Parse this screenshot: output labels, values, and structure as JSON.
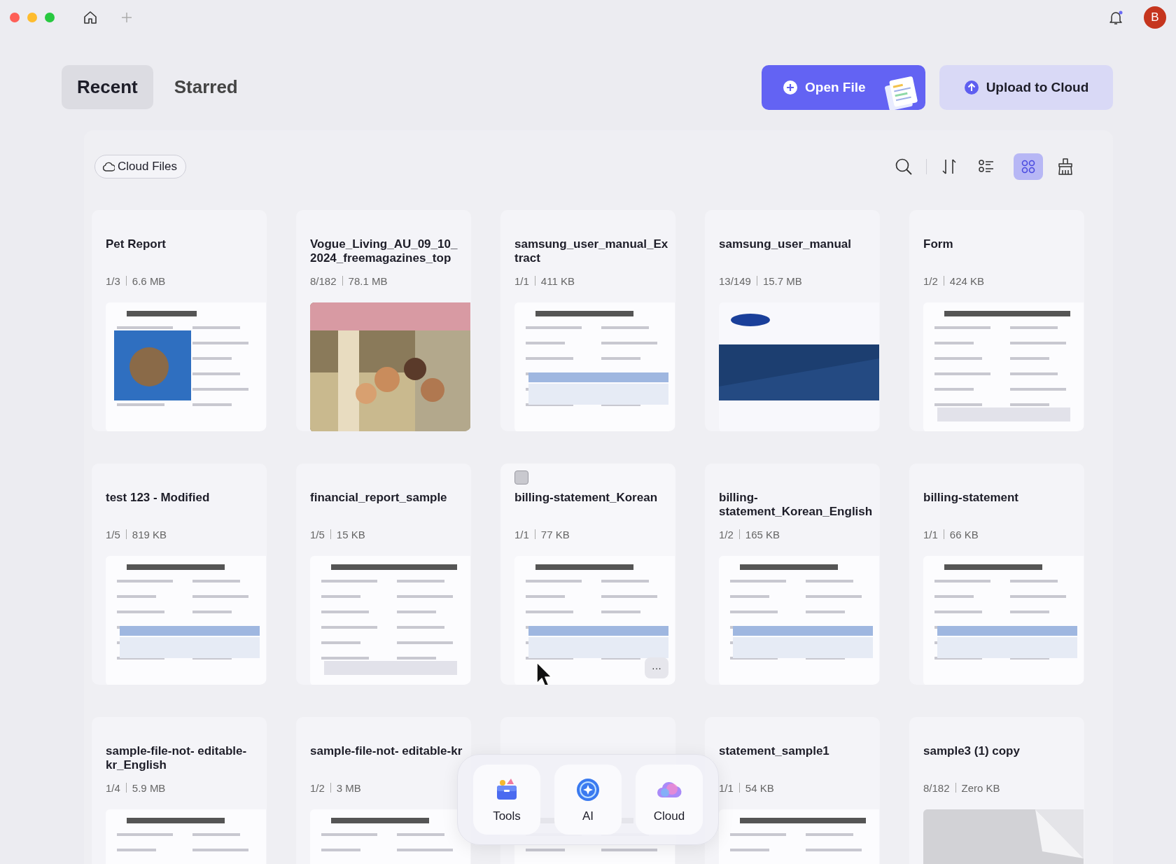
{
  "titlebar": {
    "avatar_initial": "B",
    "notification_dot": true
  },
  "tabs": [
    {
      "label": "Recent",
      "selected": true
    },
    {
      "label": "Starred",
      "selected": false
    }
  ],
  "actions": [
    {
      "label": "Open File",
      "kind": "primary"
    },
    {
      "label": "Upload to Cloud",
      "kind": "secondary"
    }
  ],
  "cloud_filter": {
    "label": "Cloud Files"
  },
  "view_buttons": [
    {
      "kind": "list",
      "selected": false
    },
    {
      "kind": "grid",
      "selected": true
    }
  ],
  "cards": [
    {
      "title": "Pet Report",
      "pages": "1/3",
      "size": "6.6 MB",
      "hovered": false
    },
    {
      "title": "Vogue_Living_AU_09_10_ 2024_freemagazines_top",
      "pages": "8/182",
      "size": "78.1 MB",
      "hovered": false
    },
    {
      "title": "samsung_user_manual_Ex tract",
      "pages": "1/1",
      "size": "411 KB",
      "hovered": false
    },
    {
      "title": "samsung_user_manual",
      "pages": "13/149",
      "size": "15.7 MB",
      "hovered": false
    },
    {
      "title": "Form",
      "pages": "1/2",
      "size": "424 KB",
      "hovered": false
    },
    {
      "title": "test 123 - Modified",
      "pages": "1/5",
      "size": "819 KB",
      "hovered": false
    },
    {
      "title": "financial_report_sample",
      "pages": "1/5",
      "size": "15 KB",
      "hovered": false
    },
    {
      "title": "billing-statement_Korean",
      "pages": "1/1",
      "size": "77 KB",
      "hovered": true,
      "more": "···"
    },
    {
      "title": "billing- statement_Korean_English",
      "pages": "1/2",
      "size": "165 KB",
      "hovered": false
    },
    {
      "title": "billing-statement",
      "pages": "1/1",
      "size": "66 KB",
      "hovered": false
    },
    {
      "title": "sample-file-not- editable-kr_English",
      "pages": "1/4",
      "size": "5.9 MB",
      "hovered": false
    },
    {
      "title": "sample-file-not- editable-kr",
      "pages": "1/2",
      "size": "3 MB",
      "hovered": false
    },
    {
      "hovered": false
    },
    {
      "title": "statement_sample1",
      "pages": "1/1",
      "size": "54 KB",
      "hovered": false
    },
    {
      "title": "sample3 (1) copy",
      "pages": "8/182",
      "size": "Zero KB",
      "hovered": false
    }
  ],
  "dock": [
    {
      "label": "Tools",
      "kind": "tools"
    },
    {
      "label": "AI",
      "kind": "ai"
    },
    {
      "label": "Cloud",
      "kind": "cloud"
    }
  ]
}
